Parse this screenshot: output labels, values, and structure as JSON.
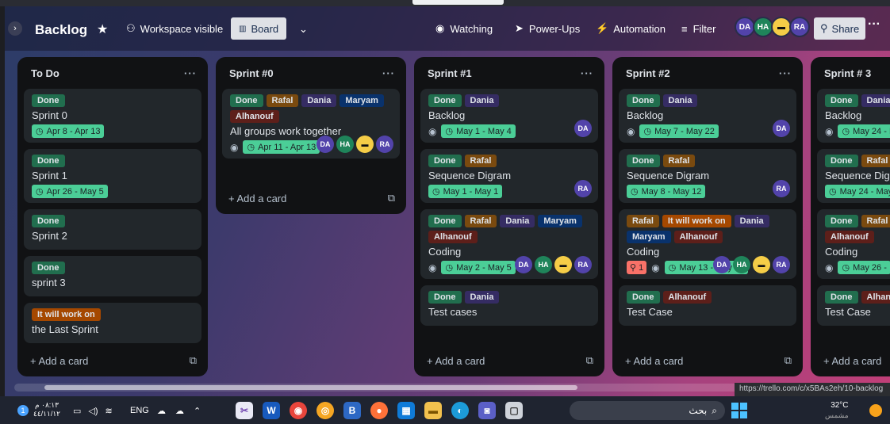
{
  "header": {
    "title": "Backlog",
    "visibility": "Workspace visible",
    "view": "Board",
    "watching": "Watching",
    "powerups": "Power-Ups",
    "automation": "Automation",
    "filter": "Filter",
    "share": "Share",
    "members": [
      {
        "initials": "DA",
        "color": "#5243aa"
      },
      {
        "initials": "HA",
        "color": "#1f845a"
      },
      {
        "initials": "",
        "color": "#f5cd47"
      },
      {
        "initials": "RA",
        "color": "#5243aa"
      }
    ]
  },
  "lists": [
    {
      "title": "To Do",
      "add": "Add a card",
      "cards": [
        {
          "labels": [
            {
              "t": "Done",
              "c": "done"
            }
          ],
          "title": "Sprint 0",
          "date": "Apr 8 - Apr 13"
        },
        {
          "labels": [
            {
              "t": "Done",
              "c": "done"
            }
          ],
          "title": "Sprint 1",
          "date": "Apr 26 - May 5"
        },
        {
          "labels": [
            {
              "t": "Done",
              "c": "done"
            }
          ],
          "title": "Sprint 2"
        },
        {
          "labels": [
            {
              "t": "Done",
              "c": "done"
            }
          ],
          "title": "sprint 3"
        },
        {
          "labels": [
            {
              "t": "It will work on",
              "c": "work"
            }
          ],
          "title": "the Last Sprint"
        }
      ]
    },
    {
      "title": "Sprint #0",
      "add": "Add a card",
      "cards": [
        {
          "labels": [
            {
              "t": "Done",
              "c": "done"
            },
            {
              "t": "Rafal",
              "c": "rafal"
            },
            {
              "t": "Dania",
              "c": "dania"
            },
            {
              "t": "Maryam",
              "c": "maryam"
            },
            {
              "t": "Alhanouf",
              "c": "alhanouf"
            }
          ],
          "title": "All groups work together",
          "eye": true,
          "date": "Apr 11 - Apr 13",
          "members": [
            "DA",
            "HA",
            "",
            "RA"
          ]
        }
      ]
    },
    {
      "title": "Sprint #1",
      "add": "Add a card",
      "cards": [
        {
          "labels": [
            {
              "t": "Done",
              "c": "done"
            },
            {
              "t": "Dania",
              "c": "dania"
            }
          ],
          "title": "Backlog",
          "eye": true,
          "date": "May 1 - May 4",
          "members": [
            "DA"
          ]
        },
        {
          "labels": [
            {
              "t": "Done",
              "c": "done"
            },
            {
              "t": "Rafal",
              "c": "rafal"
            }
          ],
          "title": "Sequence Digram",
          "date": "May 1 - May 1",
          "members": [
            "RA"
          ]
        },
        {
          "labels": [
            {
              "t": "Done",
              "c": "done"
            },
            {
              "t": "Rafal",
              "c": "rafal"
            },
            {
              "t": "Dania",
              "c": "dania"
            },
            {
              "t": "Maryam",
              "c": "maryam"
            },
            {
              "t": "Alhanouf",
              "c": "alhanouf"
            }
          ],
          "title": "Coding",
          "eye": true,
          "date": "May 2 - May 5",
          "members": [
            "DA",
            "HA",
            "",
            "RA"
          ]
        },
        {
          "labels": [
            {
              "t": "Done",
              "c": "done"
            },
            {
              "t": "Dania",
              "c": "dania"
            }
          ],
          "title": "Test cases"
        }
      ]
    },
    {
      "title": "Sprint #2",
      "add": "Add a card",
      "cards": [
        {
          "labels": [
            {
              "t": "Done",
              "c": "done"
            },
            {
              "t": "Dania",
              "c": "dania"
            }
          ],
          "title": "Backlog",
          "eye": true,
          "date": "May 7 - May 22",
          "members": [
            "DA"
          ]
        },
        {
          "labels": [
            {
              "t": "Done",
              "c": "done"
            },
            {
              "t": "Rafal",
              "c": "rafal"
            }
          ],
          "title": "Sequence Digram",
          "date": "May 8 - May 12",
          "members": [
            "RA"
          ]
        },
        {
          "labels": [
            {
              "t": "Rafal",
              "c": "rafal"
            },
            {
              "t": "It will work on",
              "c": "work"
            },
            {
              "t": "Dania",
              "c": "dania"
            },
            {
              "t": "Maryam",
              "c": "maryam"
            },
            {
              "t": "Alhanouf",
              "c": "alhanouf"
            }
          ],
          "title": "Coding",
          "pin": "1",
          "eye": true,
          "date": "May 13 - May 23",
          "members": [
            "DA",
            "HA",
            "",
            "RA"
          ]
        },
        {
          "labels": [
            {
              "t": "Done",
              "c": "done"
            },
            {
              "t": "Alhanouf",
              "c": "alhanouf"
            }
          ],
          "title": "Test Case"
        }
      ]
    },
    {
      "title": "Sprint # 3",
      "add": "Add a card",
      "cards": [
        {
          "labels": [
            {
              "t": "Done",
              "c": "done"
            },
            {
              "t": "Dania",
              "c": "dania"
            }
          ],
          "title": "Backlog",
          "eye": true,
          "date": "May 24 - May 2"
        },
        {
          "labels": [
            {
              "t": "Done",
              "c": "done"
            },
            {
              "t": "Rafal",
              "c": "rafal"
            }
          ],
          "title": "Sequence Digram",
          "date": "May 24 - May"
        },
        {
          "labels": [
            {
              "t": "Done",
              "c": "done"
            },
            {
              "t": "Rafal",
              "c": "rafal"
            },
            {
              "t": "Maryam",
              "c": "maryam"
            },
            {
              "t": "Alhanouf",
              "c": "alhanouf"
            }
          ],
          "title": "Coding",
          "eye": true,
          "date": "May 26 -"
        },
        {
          "labels": [
            {
              "t": "Done",
              "c": "done"
            },
            {
              "t": "Alhanouf",
              "c": "alhanouf"
            }
          ],
          "title": "Test Case"
        }
      ]
    }
  ],
  "status_url": "https://trello.com/c/x5BAs2eh/10-backlog",
  "taskbar": {
    "time": "٠٨:١٣ م",
    "date": "٤٤/١١/١٢",
    "lang": "ENG",
    "search": "بحث",
    "temp": "32°C",
    "weather": "مشمس"
  }
}
